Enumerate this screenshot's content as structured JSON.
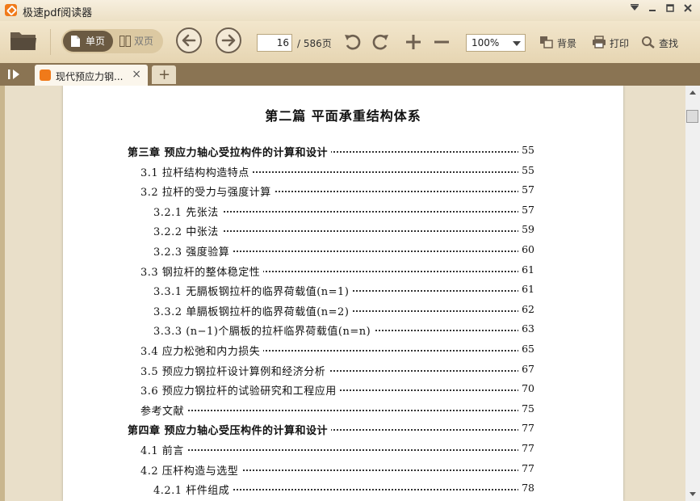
{
  "app": {
    "title": "极速pdf阅读器",
    "accent": "#f07a1a"
  },
  "window_controls": {
    "menu_icon": "menu-icon",
    "minimize_icon": "minimize-icon",
    "maximize_icon": "maximize-icon",
    "close_icon": "close-icon"
  },
  "toolbar": {
    "view_single_label": "单页",
    "view_double_label": "双页",
    "current_page": "16",
    "total_pages": "/ 586页",
    "zoom": "100%",
    "background_label": "背景",
    "print_label": "打印",
    "search_label": "查找"
  },
  "tabs": [
    {
      "label": "现代预应力钢...",
      "close": "×"
    }
  ],
  "new_tab_label": "+",
  "document": {
    "heading": "第二篇   平面承重结构体系",
    "toc": [
      {
        "level": 0,
        "text": "第三章   预应力轴心受拉构件的计算和设计",
        "page": "55"
      },
      {
        "level": 1,
        "text": "3.1   拉杆结构构造特点",
        "page": "55"
      },
      {
        "level": 1,
        "text": "3.2   拉杆的受力与强度计算",
        "page": "57"
      },
      {
        "level": 2,
        "text": "3.2.1   先张法",
        "page": "57"
      },
      {
        "level": 2,
        "text": "3.2.2   中张法",
        "page": "59"
      },
      {
        "level": 2,
        "text": "3.2.3   强度验算",
        "page": "60"
      },
      {
        "level": 1,
        "text": "3.3   钢拉杆的整体稳定性",
        "page": "61"
      },
      {
        "level": 2,
        "text": "3.3.1   无膈板钢拉杆的临界荷载值(n=1)",
        "page": "61"
      },
      {
        "level": 2,
        "text": "3.3.2   单膈板钢拉杆的临界荷载值(n=2)",
        "page": "62"
      },
      {
        "level": 2,
        "text": "3.3.3   (n−1)个膈板的拉杆临界荷载值(n=n)",
        "page": "63"
      },
      {
        "level": 1,
        "text": "3.4   应力松弛和内力损失",
        "page": "65"
      },
      {
        "level": 1,
        "text": "3.5   预应力钢拉杆设计算例和经济分析",
        "page": "67"
      },
      {
        "level": 1,
        "text": "3.6   预应力钢拉杆的试验研究和工程应用",
        "page": "70"
      },
      {
        "level": 1,
        "text": "参考文献",
        "page": "75"
      },
      {
        "level": 0,
        "text": "第四章   预应力轴心受压构件的计算和设计",
        "page": "77"
      },
      {
        "level": 1,
        "text": "4.1   前言",
        "page": "77"
      },
      {
        "level": 1,
        "text": "4.2   压杆构造与选型",
        "page": "77"
      },
      {
        "level": 2,
        "text": "4.2.1   杆件组成",
        "page": "78"
      }
    ]
  }
}
